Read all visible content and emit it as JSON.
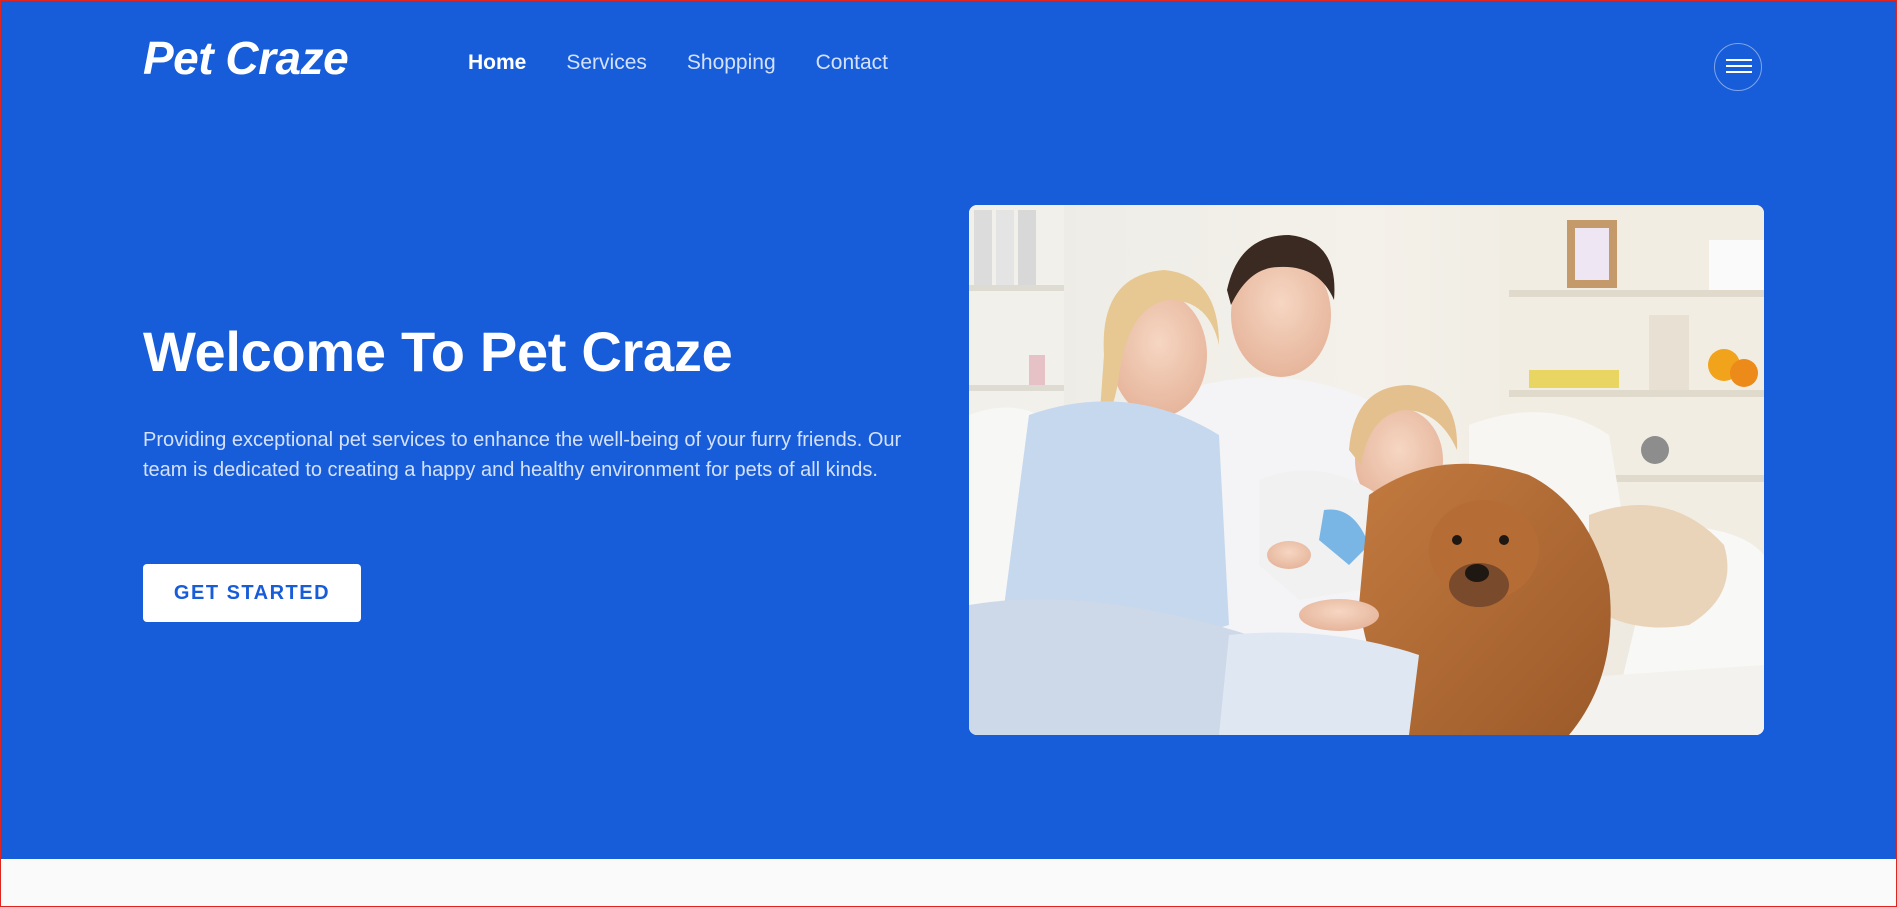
{
  "header": {
    "brand": "Pet Craze",
    "nav": [
      {
        "label": "Home",
        "active": true
      },
      {
        "label": "Services",
        "active": false
      },
      {
        "label": "Shopping",
        "active": false
      },
      {
        "label": "Contact",
        "active": false
      }
    ],
    "menu_icon": "hamburger-menu-icon"
  },
  "hero": {
    "title": "Welcome To Pet Craze",
    "description": "Providing exceptional pet services to enhance the well-being of your furry friends. Our team is dedicated to creating a happy and healthy environment for pets of all kinds.",
    "cta_label": "GET STARTED"
  },
  "colors": {
    "hero_background": "#175cd8",
    "nav_inactive": "#d4e1fb",
    "page_background": "#fafafa"
  }
}
